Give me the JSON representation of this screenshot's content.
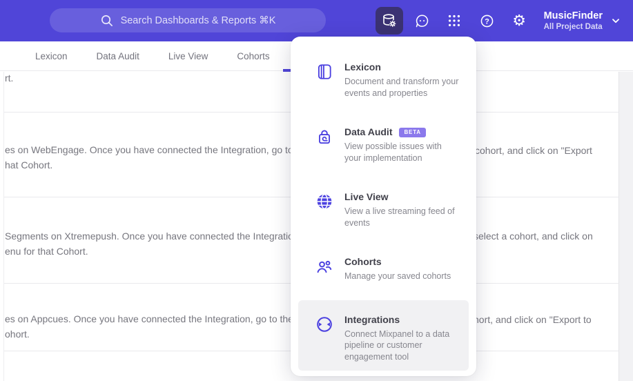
{
  "colors": {
    "header_bg": "#5045d8",
    "accent": "#4b40e0",
    "badge_bg": "#8b79ec",
    "hover_bg": "#f1f1f3",
    "active_icon_bg": "#3b3273"
  },
  "header": {
    "search_placeholder": "Search Dashboards & Reports ⌘K",
    "project_name": "MusicFinder",
    "project_scope": "All Project Data",
    "icons": [
      "database-gear-icon",
      "feedback-smiley-icon",
      "apps-grid-icon",
      "help-icon",
      "gear-icon",
      "chevron-down-icon"
    ]
  },
  "tabs": [
    {
      "label": "Lexicon"
    },
    {
      "label": "Data Audit"
    },
    {
      "label": "Live View"
    },
    {
      "label": "Cohorts"
    }
  ],
  "menu": {
    "items": [
      {
        "title": "Lexicon",
        "icon": "book-icon",
        "desc": "Document and transform your events and properties"
      },
      {
        "title": "Data Audit",
        "icon": "audit-lock-icon",
        "badge": "BETA",
        "desc": "View possible issues with your implementation"
      },
      {
        "title": "Live View",
        "icon": "globe-icon",
        "desc": "View a live streaming feed of events"
      },
      {
        "title": "Cohorts",
        "icon": "people-icon",
        "desc": "Manage your saved cohorts"
      },
      {
        "title": "Integrations",
        "icon": "sync-arrows-icon",
        "desc": "Connect Mixpanel to a data pipeline or customer engagement tool"
      }
    ]
  },
  "background_text": {
    "row1_left": "rt.",
    "row2_left1": "es on WebEngage. Once you have connected the Integration, go to the",
    "row2_right1": "cohort, and click on \"Export",
    "row2_left2": "hat Cohort.",
    "row3_left1": "Segments on Xtremepush. Once you have connected the Integration,",
    "row3_right1": "select a cohort, and click on",
    "row3_left2": "enu for that Cohort.",
    "row4_left1": "es on Appcues. Once you have connected the Integration, go to the M",
    "row4_right1": "hort, and click on \"Export to",
    "row4_left2": "ohort."
  }
}
